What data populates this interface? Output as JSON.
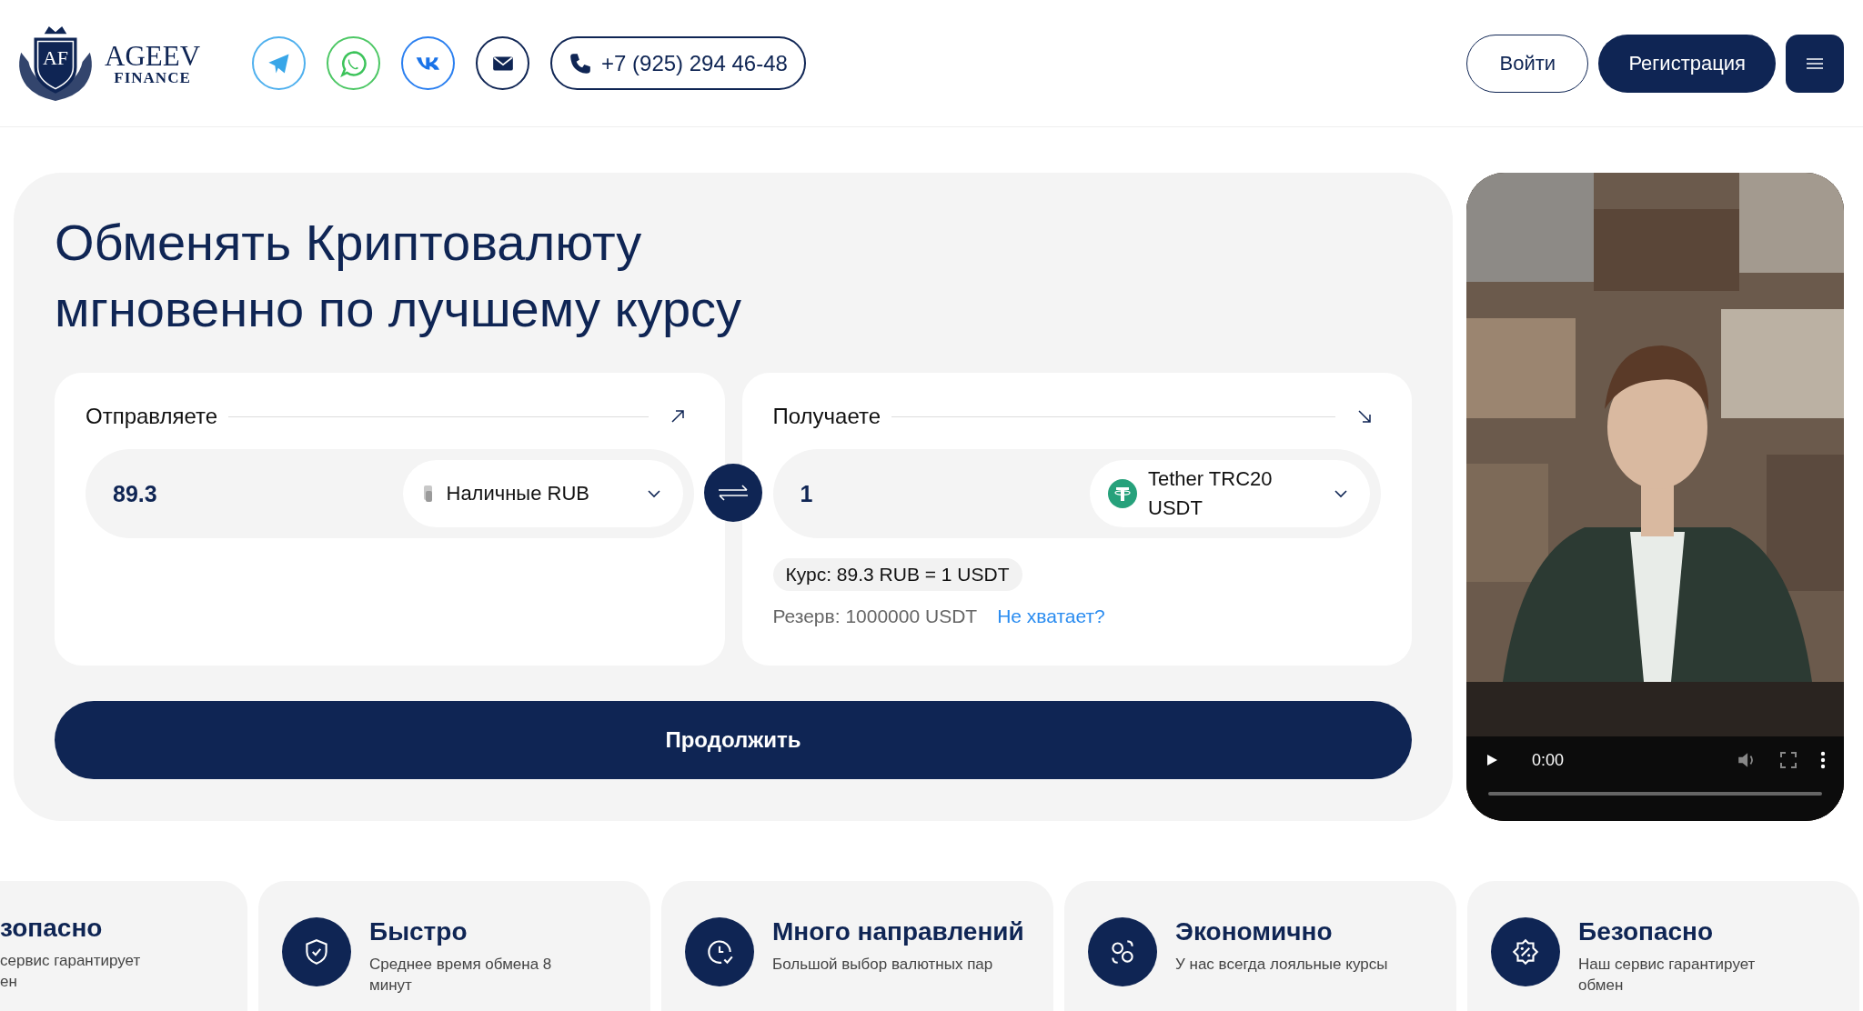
{
  "header": {
    "logo": {
      "monogram": "AF",
      "line1": "AGEEV",
      "line2": "FINANCE"
    },
    "phone": "+7 (925) 294 46-48",
    "login": "Войти",
    "register": "Регистрация"
  },
  "exchange": {
    "title": "Обменять Криптовалюту мгновенно по лучшему курсу",
    "send": {
      "label": "Отправляете",
      "amount": "89.3",
      "currency": "Наличные RUB"
    },
    "receive": {
      "label": "Получаете",
      "amount": "1",
      "currency": "Tether TRC20 USDT"
    },
    "rate": "Курс: 89.3 RUB = 1 USDT",
    "reserve": "Резерв: 1000000 USDT",
    "reserve_link": "Не хватает?",
    "submit": "Продолжить"
  },
  "video": {
    "kind": "picture",
    "time": "0:00",
    "level": 0
  },
  "features": [
    {
      "kind": "partial",
      "title": "зопасно",
      "text": "сервис гарантирует ен"
    },
    {
      "kind": "full",
      "title": "Быстро",
      "text": "Среднее время обмена 8 минут"
    },
    {
      "kind": "full",
      "title": "Много направлений",
      "text": "Большой выбор валютных пар"
    },
    {
      "kind": "full",
      "title": "Экономично",
      "text": "У нас всегда лояльные курсы"
    },
    {
      "kind": "full",
      "title": "Безопасно",
      "text": "Наш сервис гарантирует обмен"
    }
  ]
}
